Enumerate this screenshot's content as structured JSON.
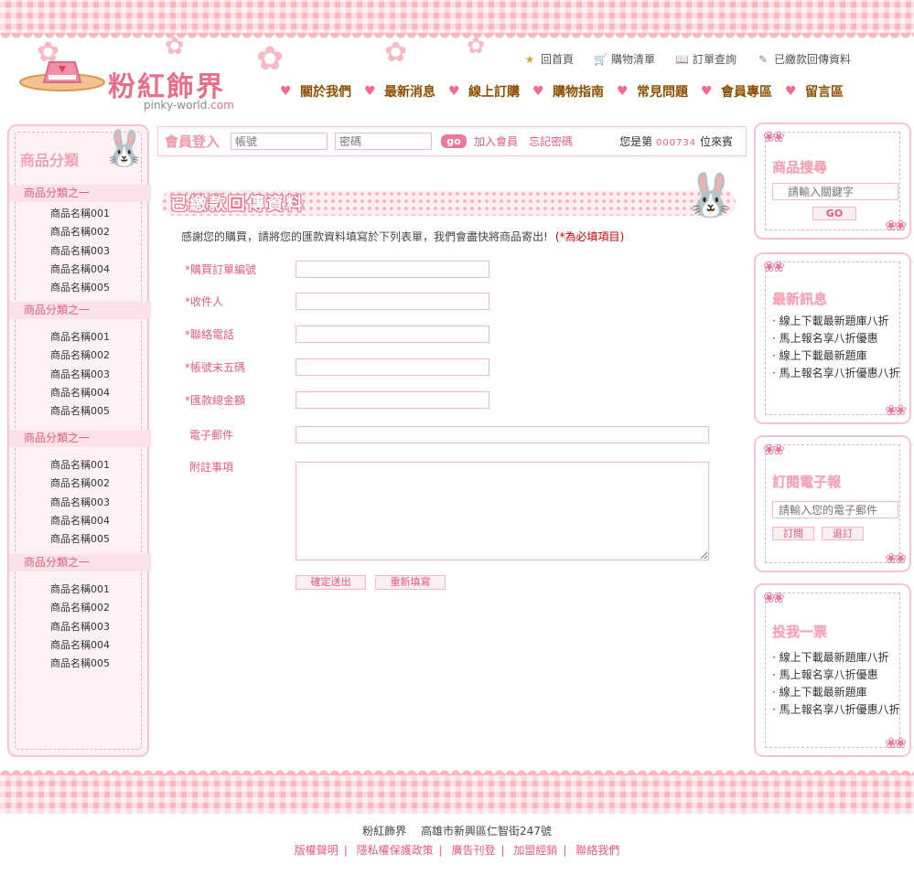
{
  "logo": {
    "title": "粉紅飾界",
    "sub_main": "pinky-world",
    "sub_suffix": ".com"
  },
  "topnav": [
    {
      "label": "回首頁",
      "icon": "star-icon"
    },
    {
      "label": "購物清單",
      "icon": "cart-icon"
    },
    {
      "label": "訂單查詢",
      "icon": "book-icon"
    },
    {
      "label": "已繳款回傳資料",
      "icon": "pencil-icon"
    }
  ],
  "mainnav": [
    "關於我們",
    "最新消息",
    "線上訂購",
    "購物指南",
    "常見問題",
    "會員專區",
    "留言區"
  ],
  "sidebar": {
    "title": "商品分類",
    "groups": [
      {
        "head": "商品分類之一",
        "items": [
          "商品名稱001",
          "商品名稱002",
          "商品名稱003",
          "商品名稱004",
          "商品名稱005"
        ]
      },
      {
        "head": "商品分類之一",
        "items": [
          "商品名稱001",
          "商品名稱002",
          "商品名稱003",
          "商品名稱004",
          "商品名稱005"
        ]
      },
      {
        "head": "商品分類之一",
        "items": [
          "商品名稱001",
          "商品名稱002",
          "商品名稱003",
          "商品名稱004",
          "商品名稱005"
        ]
      },
      {
        "head": "商品分類之一",
        "items": [
          "商品名稱001",
          "商品名稱002",
          "商品名稱003",
          "商品名稱004",
          "商品名稱005"
        ]
      }
    ]
  },
  "login": {
    "label": "會員登入",
    "account_placeholder": "帳號",
    "password_placeholder": "密碼",
    "go": "go",
    "join": "加入會員",
    "forgot": "忘記密碼",
    "visitor_prefix": "您是第",
    "visitor_number": "000734",
    "visitor_suffix": "位來賓"
  },
  "page": {
    "title": "已繳款回傳資料",
    "intro": "感謝您的購買，請將您的匯款資料填寫於下列表單，我們會盡快將商品寄出!",
    "required_note": "(*為必填項目)",
    "fields": [
      {
        "label": "購買訂單編號",
        "required": true
      },
      {
        "label": "收件人",
        "required": true
      },
      {
        "label": "聯絡電話",
        "required": true
      },
      {
        "label": "帳號末五碼",
        "required": true
      },
      {
        "label": "匯款總金額",
        "required": true
      },
      {
        "label": "電子郵件",
        "required": false
      }
    ],
    "remark_label": "附註事項",
    "submit": "確定送出",
    "reset": "重新填寫"
  },
  "search_box": {
    "title": "商品搜尋",
    "placeholder": "請輸入關鍵字",
    "button": "GO"
  },
  "news_box": {
    "title": "最新訊息",
    "items": [
      "線上下載最新題庫八折",
      "馬上報名享八折優惠",
      "線上下載最新題庫",
      "馬上報名享八折優惠八折"
    ]
  },
  "newsletter_box": {
    "title": "訂閱電子報",
    "placeholder": "請輸入您的電子郵件",
    "subscribe": "訂閱",
    "unsubscribe": "退訂"
  },
  "vote_box": {
    "title": "投我一票",
    "items": [
      "線上下載最新題庫八折",
      "馬上報名享八折優惠",
      "線上下載最新題庫",
      "馬上報名享八折優惠八折"
    ]
  },
  "footer": {
    "info": "粉紅飾界　 高雄市新興區仁智街247號",
    "links": [
      "版權聲明",
      "隱私權保護政策",
      "廣告刊登",
      "加盟經銷",
      "聯絡我們"
    ]
  },
  "colors": {
    "accent": "#e05d82",
    "pink_light": "#fdf1f4",
    "border": "#f5c6d0",
    "nav_text": "#8a4e00"
  }
}
